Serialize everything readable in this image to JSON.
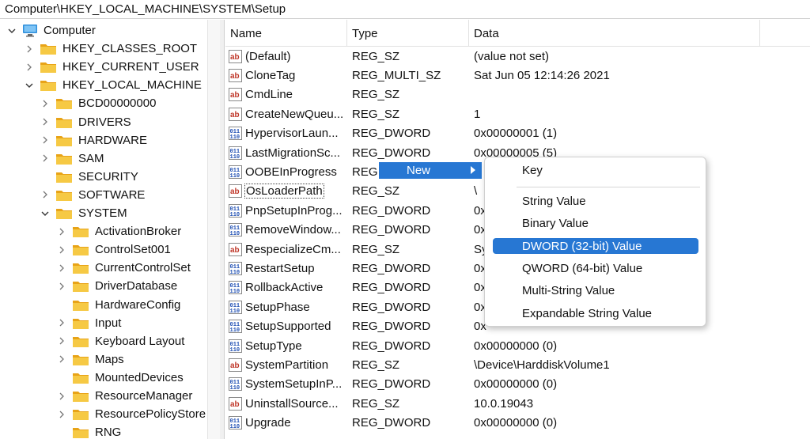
{
  "address": "Computer\\HKEY_LOCAL_MACHINE\\SYSTEM\\Setup",
  "tree": {
    "root": "Computer",
    "hives": [
      "HKEY_CLASSES_ROOT",
      "HKEY_CURRENT_USER",
      "HKEY_LOCAL_MACHINE"
    ],
    "hklm_keys": [
      "BCD00000000",
      "DRIVERS",
      "HARDWARE",
      "SAM",
      "SECURITY",
      "SOFTWARE",
      "SYSTEM"
    ],
    "system_keys": [
      "ActivationBroker",
      "ControlSet001",
      "CurrentControlSet",
      "DriverDatabase",
      "HardwareConfig",
      "Input",
      "Keyboard Layout",
      "Maps",
      "MountedDevices",
      "ResourceManager",
      "ResourcePolicyStore",
      "RNG"
    ]
  },
  "columns": {
    "name": "Name",
    "type": "Type",
    "data": "Data"
  },
  "values": [
    {
      "name": "(Default)",
      "type": "REG_SZ",
      "data": "(value not set)",
      "icon": "string-value-icon"
    },
    {
      "name": "CloneTag",
      "type": "REG_MULTI_SZ",
      "data": "Sat Jun 05 12:14:26 2021",
      "icon": "string-value-icon"
    },
    {
      "name": "CmdLine",
      "type": "REG_SZ",
      "data": "",
      "icon": "string-value-icon"
    },
    {
      "name": "CreateNewQueu...",
      "type": "REG_SZ",
      "data": "1",
      "icon": "string-value-icon"
    },
    {
      "name": "HypervisorLaun...",
      "type": "REG_DWORD",
      "data": "0x00000001 (1)",
      "icon": "binary-value-icon"
    },
    {
      "name": "LastMigrationSc...",
      "type": "REG_DWORD",
      "data": "0x00000005 (5)",
      "icon": "binary-value-icon"
    },
    {
      "name": "OOBEInProgress",
      "type": "REG",
      "data": "",
      "icon": "binary-value-icon"
    },
    {
      "name": "OsLoaderPath",
      "type": "REG_SZ",
      "data": "\\",
      "icon": "string-value-icon"
    },
    {
      "name": "PnpSetupInProg...",
      "type": "REG_DWORD",
      "data": "0x",
      "icon": "binary-value-icon"
    },
    {
      "name": "RemoveWindow...",
      "type": "REG_DWORD",
      "data": "0x",
      "icon": "binary-value-icon"
    },
    {
      "name": "RespecializeCm...",
      "type": "REG_SZ",
      "data": "Sy",
      "icon": "string-value-icon"
    },
    {
      "name": "RestartSetup",
      "type": "REG_DWORD",
      "data": "0x",
      "icon": "binary-value-icon"
    },
    {
      "name": "RollbackActive",
      "type": "REG_DWORD",
      "data": "0x",
      "icon": "binary-value-icon"
    },
    {
      "name": "SetupPhase",
      "type": "REG_DWORD",
      "data": "0x",
      "icon": "binary-value-icon"
    },
    {
      "name": "SetupSupported",
      "type": "REG_DWORD",
      "data": "0x",
      "icon": "binary-value-icon"
    },
    {
      "name": "SetupType",
      "type": "REG_DWORD",
      "data": "0x00000000 (0)",
      "icon": "binary-value-icon"
    },
    {
      "name": "SystemPartition",
      "type": "REG_SZ",
      "data": "\\Device\\HarddiskVolume1",
      "icon": "string-value-icon"
    },
    {
      "name": "SystemSetupInP...",
      "type": "REG_DWORD",
      "data": "0x00000000 (0)",
      "icon": "binary-value-icon"
    },
    {
      "name": "UninstallSource...",
      "type": "REG_SZ",
      "data": "10.0.19043",
      "icon": "string-value-icon"
    },
    {
      "name": "Upgrade",
      "type": "REG_DWORD",
      "data": "0x00000000 (0)",
      "icon": "binary-value-icon"
    }
  ],
  "context_menu": {
    "new_label": "New"
  },
  "submenu": {
    "items": [
      "Key",
      "String Value",
      "Binary Value",
      "DWORD (32-bit) Value",
      "QWORD (64-bit) Value",
      "Multi-String Value",
      "Expandable String Value"
    ],
    "highlighted": "DWORD (32-bit) Value"
  },
  "colors": {
    "highlight": "#2777d3",
    "folder": "#f4c430"
  }
}
